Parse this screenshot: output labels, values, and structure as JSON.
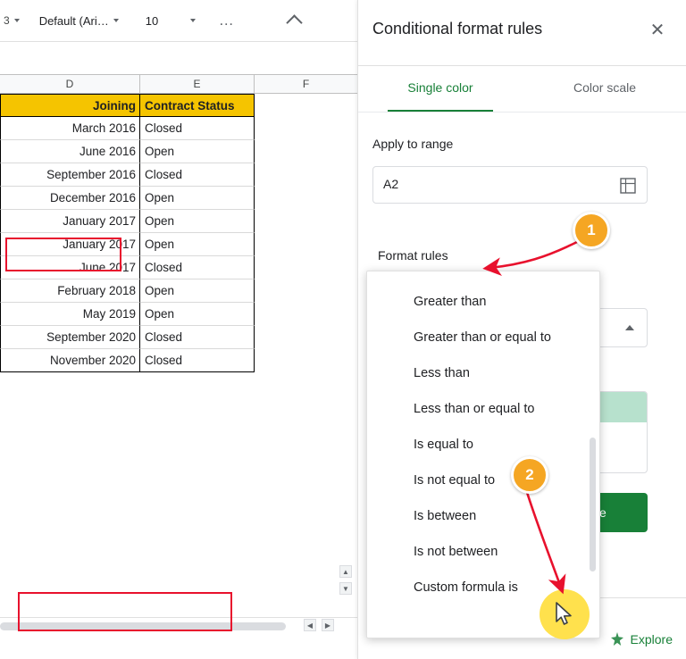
{
  "toolbar": {
    "zoom_label": "3",
    "font_name": "Default (Ari…",
    "font_size": "10",
    "more_label": "…",
    "collapse_icon": "chevron-up"
  },
  "sheet": {
    "columns": [
      {
        "label": "D"
      },
      {
        "label": "E"
      },
      {
        "label": "F"
      }
    ],
    "rows": [
      {
        "d": "Joining",
        "e": "Contract Status",
        "header": true
      },
      {
        "d": "March 2016",
        "e": "Closed"
      },
      {
        "d": "June 2016",
        "e": "Open"
      },
      {
        "d": "September 2016",
        "e": "Closed"
      },
      {
        "d": "December 2016",
        "e": "Open"
      },
      {
        "d": "January 2017",
        "e": "Open"
      },
      {
        "d": "January 2017",
        "e": "Open"
      },
      {
        "d": "June 2017",
        "e": "Closed"
      },
      {
        "d": "February 2018",
        "e": "Open"
      },
      {
        "d": "May 2019",
        "e": "Open"
      },
      {
        "d": "September 2020",
        "e": "Closed"
      },
      {
        "d": "November 2020",
        "e": "Closed"
      }
    ],
    "scroll_up_glyph": "▲",
    "scroll_down_glyph": "▼",
    "scroll_left_glyph": "◀",
    "scroll_right_glyph": "▶"
  },
  "panel": {
    "title": "Conditional format rules",
    "close_label": "✕",
    "tabs": [
      {
        "label": "Single color",
        "active": true
      },
      {
        "label": "Color scale",
        "active": false
      }
    ],
    "apply_to_range_label": "Apply to range",
    "range_value": "A2",
    "format_rules_label": "Format rules",
    "done_label": "ne",
    "explore_label": "Explore"
  },
  "dropdown": {
    "items": [
      {
        "label": "Greater than"
      },
      {
        "label": "Greater than or equal to"
      },
      {
        "label": "Less than"
      },
      {
        "label": "Less than or equal to"
      },
      {
        "label": "Is equal to"
      },
      {
        "label": "Is not equal to"
      },
      {
        "label": "Is between"
      },
      {
        "label": "Is not between"
      },
      {
        "label": "Custom formula is"
      }
    ]
  },
  "annotations": {
    "badge1": "1",
    "badge2": "2"
  },
  "colors": {
    "accent_green": "#188038",
    "header_yellow": "#f5c400",
    "badge_orange": "#f5a623",
    "highlight_red": "#e8112d",
    "cursor_halo": "#ffe14d",
    "preview_green": "#b7e1cd"
  }
}
